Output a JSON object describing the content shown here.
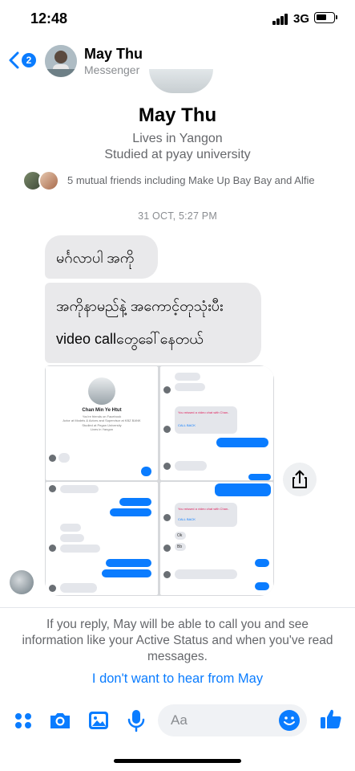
{
  "status_bar": {
    "time": "12:48",
    "network": "3G"
  },
  "header": {
    "back_badge": "2",
    "name": "May Thu",
    "subtitle": "Messenger"
  },
  "profile": {
    "name": "May Thu",
    "lives_in": "Lives in Yangon",
    "studied_at": "Studied at pyay university",
    "mutual_friends": "5 mutual friends including Make Up Bay Bay and Alfie"
  },
  "conversation": {
    "timestamp": "31 OCT, 5:27 PM",
    "messages": [
      {
        "text": "မင်္ဂလာပါ အကို"
      },
      {
        "line1": "အကိုနာမည်နဲ့ အကောင့်တုသုံးပီး",
        "line2": "video callတွေခေါ်နေတယ်"
      }
    ],
    "attachment": {
      "profile_name": "Chan Min Ye Htut",
      "profile_line": "You're friends on Facebook",
      "profile_bio": "Actor at Models & Actors and Supervisor at KBZ BANK",
      "profile_study": "Studied at Pegan University",
      "profile_lives": "Lives in Yangon",
      "missed_call": "You missed a video chat with Chan..",
      "call_back": "CALL BACK",
      "ok_text": "Ok",
      "bb_text": "Bb"
    }
  },
  "request_notice": {
    "text": "If you reply, May will be able to call you and see information like your Active Status and when you've read messages.",
    "link": "I don't want to hear from May"
  },
  "composer": {
    "placeholder": "Aa"
  },
  "colors": {
    "accent": "#0a7cff",
    "bubble_gray": "#e9e9eb",
    "muted_text": "#65676b"
  }
}
